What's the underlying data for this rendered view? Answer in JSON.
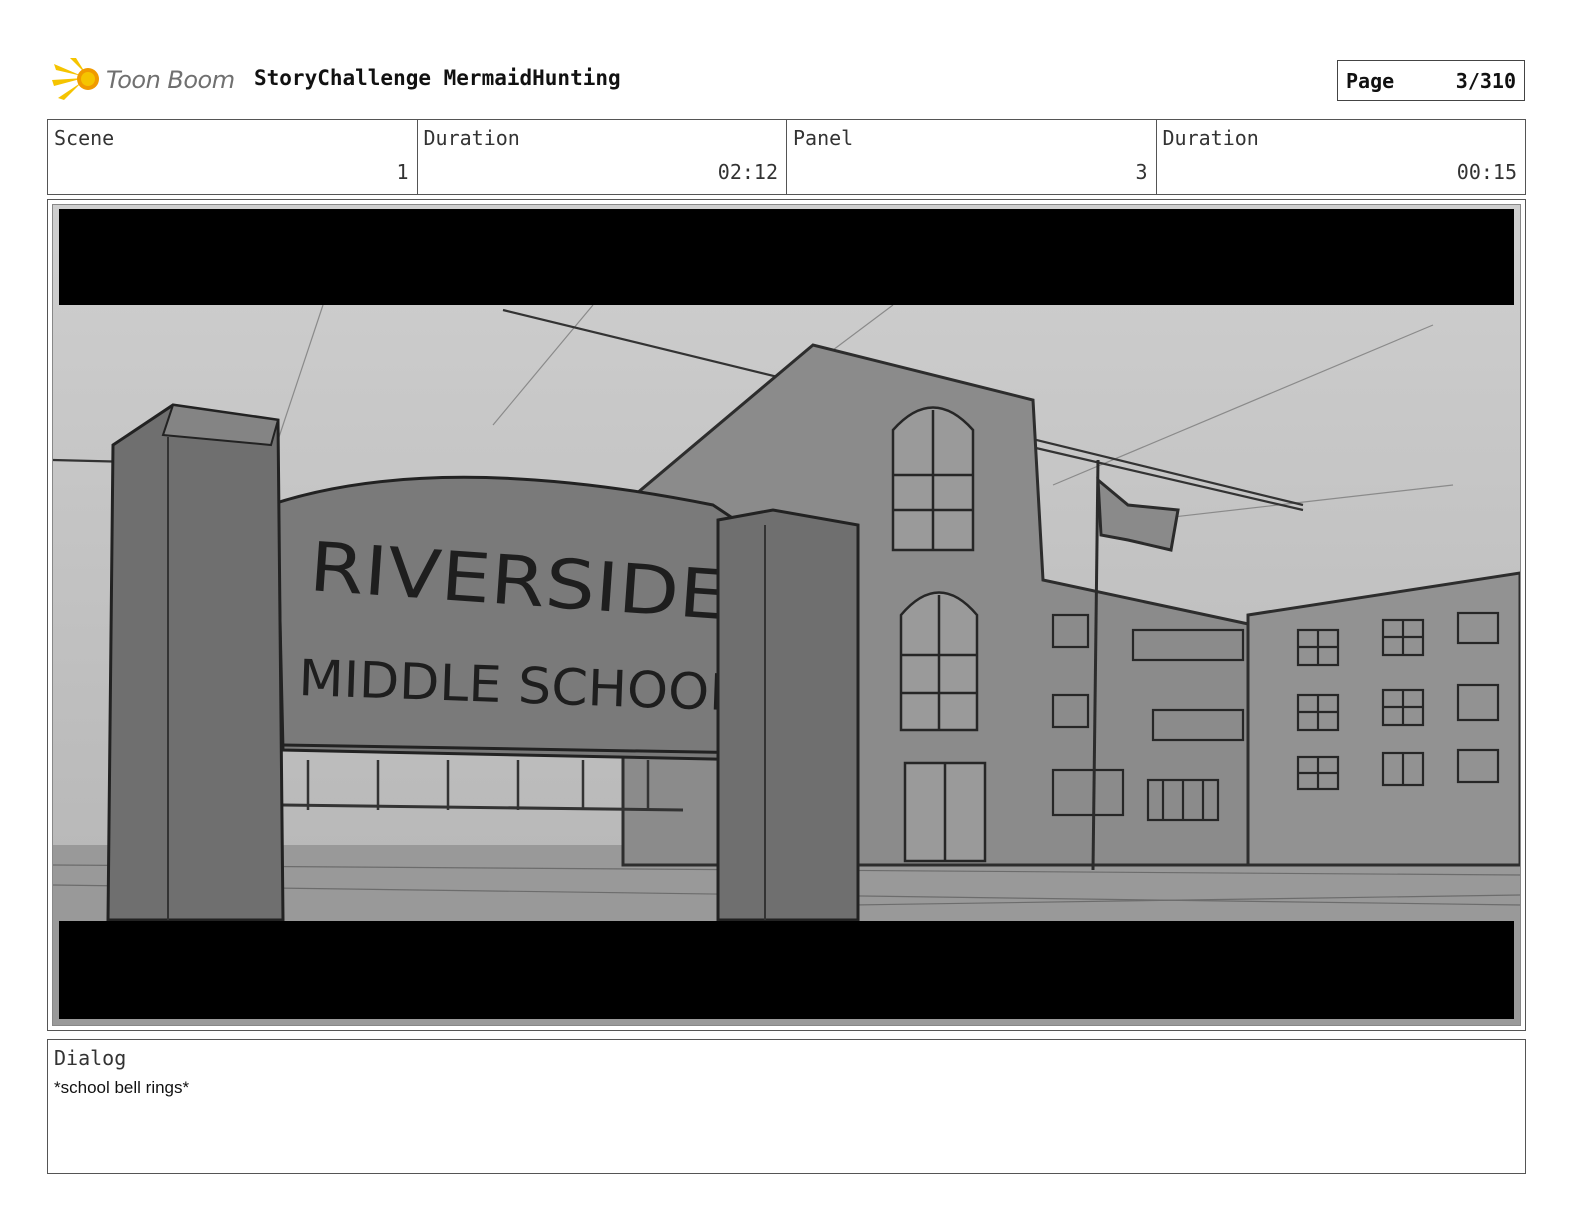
{
  "header": {
    "logo_text": "Toon Boom",
    "title": "StoryChallenge MermaidHunting",
    "page_label": "Page",
    "page_value": "3/310"
  },
  "info": {
    "scene_label": "Scene",
    "scene_value": "1",
    "scene_duration_label": "Duration",
    "scene_duration_value": "02:12",
    "panel_label": "Panel",
    "panel_value": "3",
    "panel_duration_label": "Duration",
    "panel_duration_value": "00:15"
  },
  "artwork": {
    "sign_line1": "RIVERSIDE",
    "sign_line2": "MIDDLE SCHOOL"
  },
  "dialog": {
    "label": "Dialog",
    "text": "*school bell rings*"
  },
  "colors": {
    "logo_yellow": "#f5c400",
    "logo_orange": "#f09a00",
    "letterbox": "#000000"
  }
}
